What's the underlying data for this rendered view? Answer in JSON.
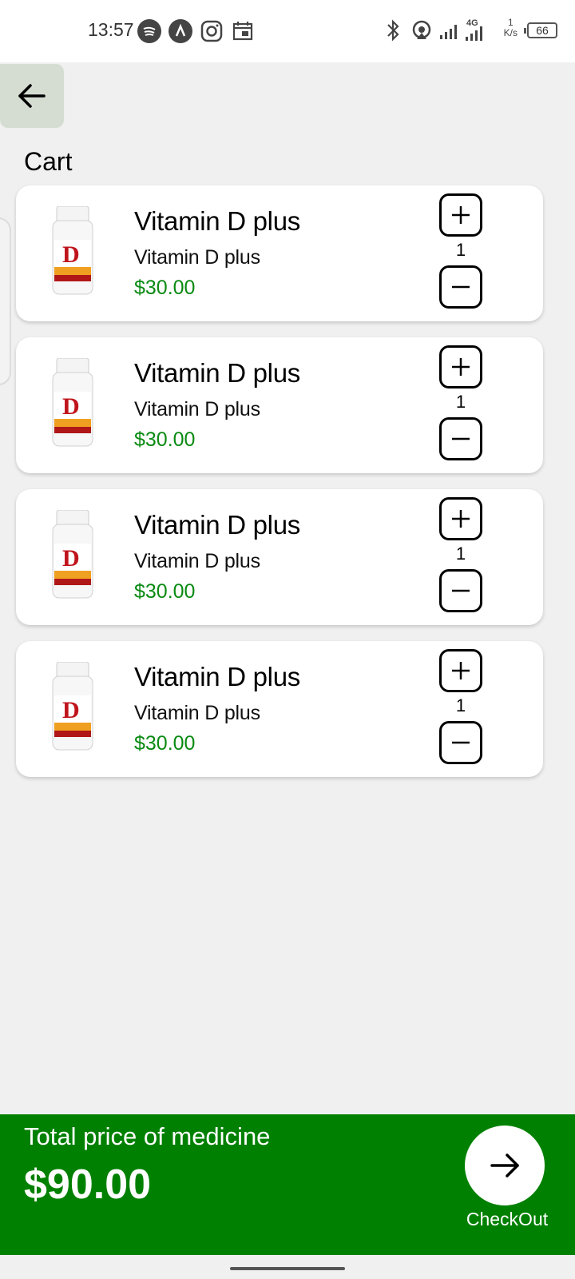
{
  "status_bar": {
    "time": "13:57",
    "icons_left": [
      "spotify-icon",
      "app-icon",
      "instagram-icon",
      "calendar-icon"
    ],
    "icons_right": [
      "bluetooth-icon",
      "hotspot-icon",
      "signal-icon",
      "signal-4g-icon"
    ],
    "network_label": "4G",
    "net_speed_value": "1",
    "net_speed_unit": "K/s",
    "battery": "66"
  },
  "header": {
    "back_icon": "arrow-left-icon",
    "title": "Cart"
  },
  "cart": {
    "items": [
      {
        "name": "Vitamin D plus",
        "subtitle": "Vitamin D plus",
        "price": "$30.00",
        "quantity": "1"
      },
      {
        "name": "Vitamin D plus",
        "subtitle": "Vitamin D plus",
        "price": "$30.00",
        "quantity": "1"
      },
      {
        "name": "Vitamin D plus",
        "subtitle": "Vitamin D plus",
        "price": "$30.00",
        "quantity": "1"
      },
      {
        "name": "Vitamin D plus",
        "subtitle": "Vitamin D plus",
        "price": "$30.00",
        "quantity": "1"
      }
    ]
  },
  "footer": {
    "total_label": "Total price of medicine",
    "total_value": "$90.00",
    "checkout_label": "CheckOut",
    "checkout_icon": "arrow-right-icon"
  },
  "colors": {
    "accent_green": "#008000",
    "price_green": "#0a8a12",
    "back_button_bg": "#d5ddd2"
  }
}
